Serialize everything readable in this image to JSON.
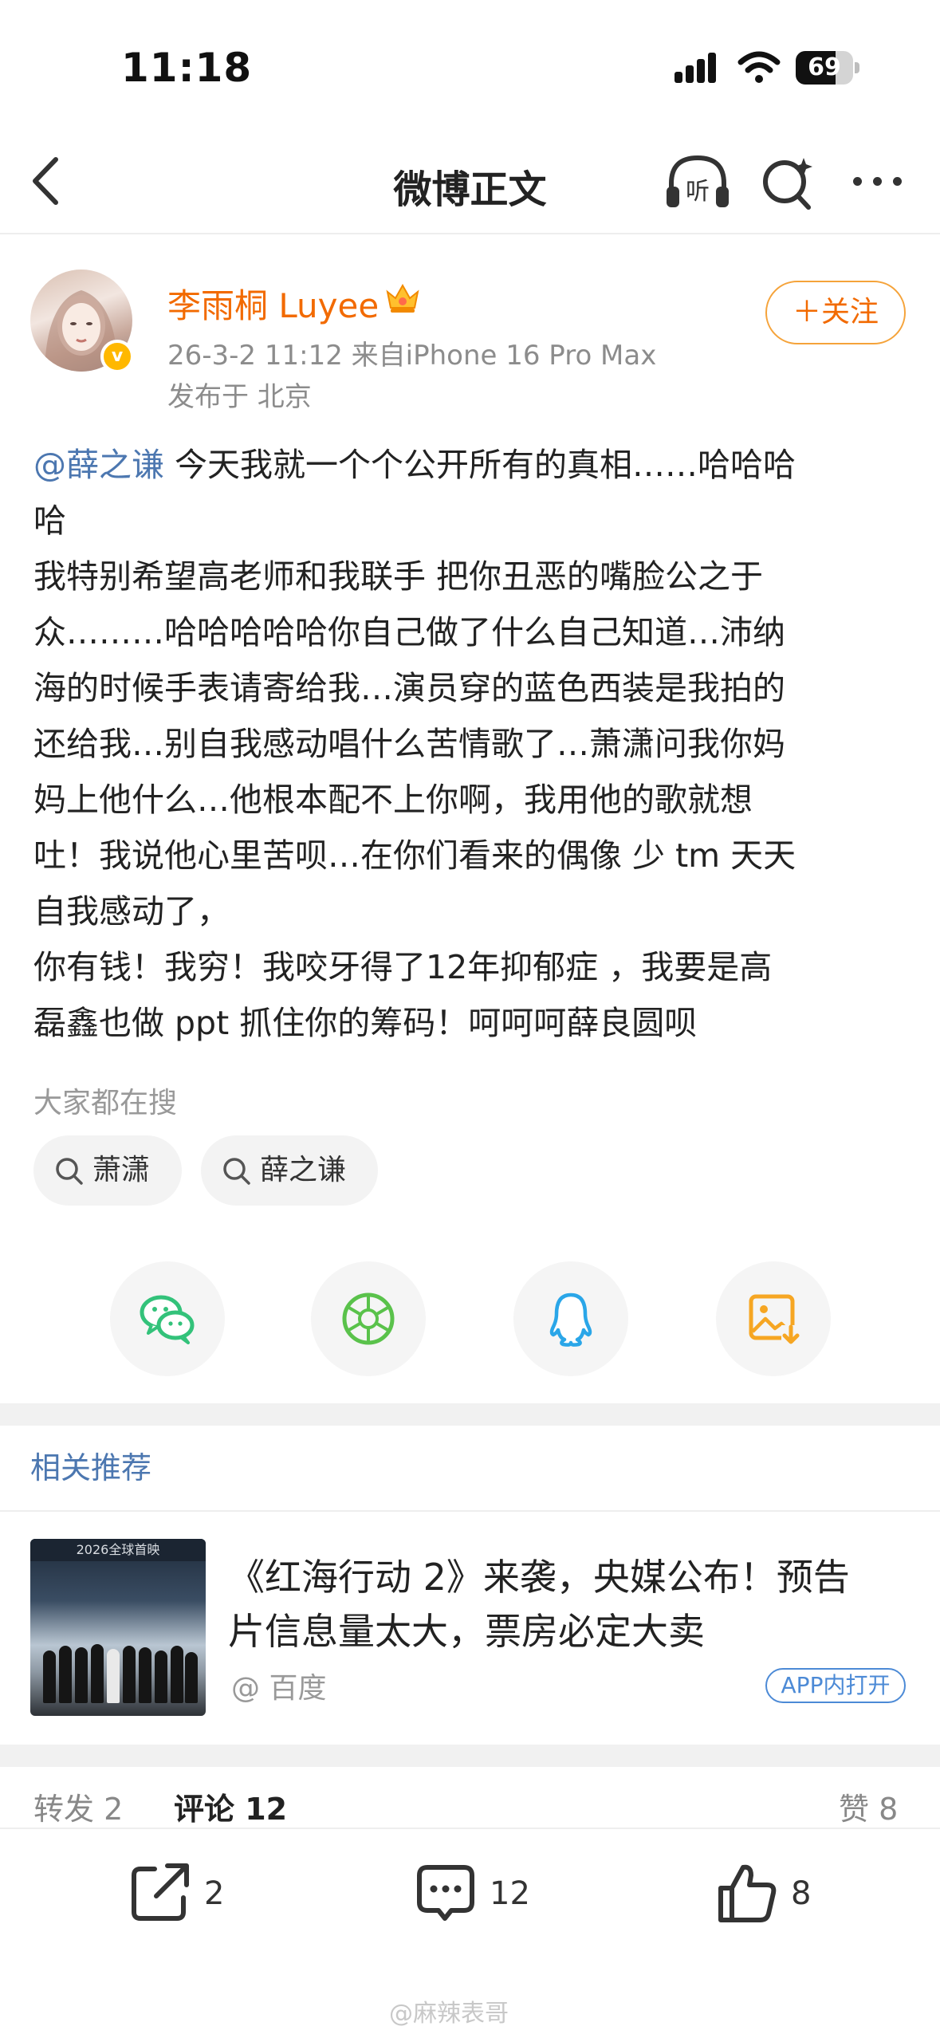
{
  "status_bar": {
    "time": "11:18",
    "battery": "69",
    "battery_level": 0.69
  },
  "nav": {
    "title": "微博正文",
    "listen_label": "听"
  },
  "post": {
    "author": "李雨桐 Luyee",
    "meta": "26-3-2 11:12  来自iPhone 16 Pro Max",
    "location": "发布于 北京",
    "follow_label": "＋关注",
    "verified_mark": "v",
    "mention": "@薛之谦",
    "lines": [
      " 今天我就一个个公开所有的真相……哈哈哈",
      "哈",
      "我特别希望高老师和我联手 把你丑恶的嘴脸公之于",
      "众………哈哈哈哈哈你自己做了什么自己知道…沛纳",
      "海的时候手表请寄给我…演员穿的蓝色西装是我拍的",
      "还给我…别自我感动唱什么苦情歌了…萧潇问我你妈",
      "妈上他什么…他根本配不上你啊，我用他的歌就想",
      "吐！我说他心里苦呗…在你们看来的偶像 少 tm 天天",
      "自我感动了，",
      "你有钱！我穷！我咬牙得了12年抑郁症 ，我要是高",
      "磊鑫也做 ppt 抓住你的筹码！呵呵呵薛良圆呗"
    ]
  },
  "search_hint": {
    "title": "大家都在搜",
    "chips": [
      "萧潇",
      "薛之谦"
    ]
  },
  "share": [
    "wechat-icon",
    "moments-icon",
    "qq-icon",
    "save-image-icon"
  ],
  "related": {
    "title": "相关推荐",
    "item": {
      "title_line1": "《红海行动 2》来袭，央媒公布！预告",
      "title_line2": "片信息量太大，票房必定大卖",
      "source": "@ 百度",
      "badge": "APP内打开",
      "thumb_caption": "2026全球首映"
    }
  },
  "tabs": {
    "repost": "转发 2",
    "comment": "评论 12",
    "like": "赞 8"
  },
  "toolbar": {
    "repost_count": "2",
    "comment_count": "12",
    "like_count": "8"
  },
  "watermark": "@麻辣表哥",
  "colors": {
    "orange": "#f26a00",
    "link_blue": "#4c77b0",
    "badge_blue": "#4c8ad6"
  }
}
